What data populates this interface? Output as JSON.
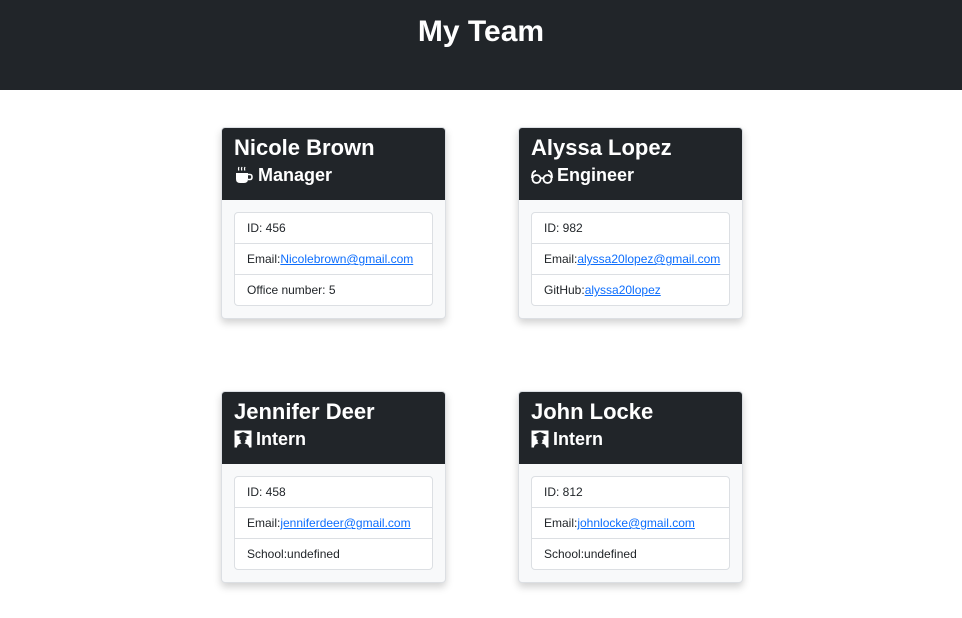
{
  "page": {
    "title": "My Team"
  },
  "cards": [
    {
      "name": "Nicole Brown",
      "role": "Manager",
      "role_icon": "coffee-icon",
      "id_text": "ID: 456",
      "email_label": "Email:",
      "email": "Nicolebrown@gmail.com",
      "extra_label": "Office number: 5",
      "extra_value": ""
    },
    {
      "name": "Alyssa Lopez",
      "role": "Engineer",
      "role_icon": "glasses-icon",
      "id_text": "ID: 982",
      "email_label": "Email:",
      "email": "alyssa20lopez@gmail.com",
      "extra_label": "GitHub:",
      "extra_value": "alyssa20lopez"
    },
    {
      "name": "Jennifer Deer",
      "role": "Intern",
      "role_icon": "graduate-icon",
      "id_text": "ID: 458",
      "email_label": "Email:",
      "email": "jenniferdeer@gmail.com",
      "extra_label": "School:undefined",
      "extra_value": ""
    },
    {
      "name": "John Locke",
      "role": "Intern",
      "role_icon": "graduate-icon",
      "id_text": "ID: 812",
      "email_label": "Email:",
      "email": "johnlocke@gmail.com",
      "extra_label": "School:undefined",
      "extra_value": ""
    }
  ],
  "colors": {
    "header_bg": "#212529",
    "link": "#0d6efd",
    "card_bg": "#f8f9fa"
  }
}
